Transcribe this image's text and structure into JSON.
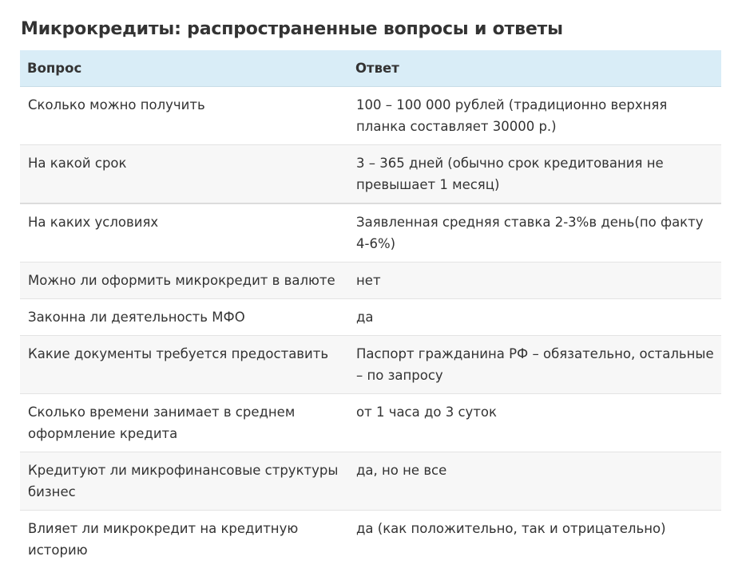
{
  "title": "Микрокредиты: распространенные вопросы и ответы",
  "table": {
    "headers": [
      "Вопрос",
      "Ответ"
    ],
    "rows": [
      {
        "q": "Сколько можно получить",
        "a": "100 – 100 000 рублей (традиционно верхняя планка составляет 30000 р.)"
      },
      {
        "q": "На какой срок",
        "a": "3 – 365 дней (обычно срок кредитования не превышает 1 месяц)"
      },
      {
        "q": "На каких условиях",
        "a": "Заявленная средняя ставка 2-3%в день(по факту 4-6%)"
      },
      {
        "q": "Можно ли оформить микрокредит в валюте",
        "a": "нет"
      },
      {
        "q": "Законна ли деятельность МФО",
        "a": "да"
      },
      {
        "q": "Какие документы требуется предоставить",
        "a": "Паспорт гражданина РФ – обязательно, остальные – по запросу"
      },
      {
        "q": "Сколько времени занимает в среднем оформление кредита",
        "a": "от 1 часа до 3 суток"
      },
      {
        "q": "Кредитуют ли микрофинансовые структуры бизнес",
        "a": "да, но не все"
      },
      {
        "q": "Влияет ли микрокредит на кредитную историю",
        "a": "да (как положительно, так и отрицательно)"
      }
    ]
  },
  "colors": {
    "header_bg": "#d9edf7",
    "stripe_bg": "#f7f7f7",
    "text": "#333333"
  }
}
